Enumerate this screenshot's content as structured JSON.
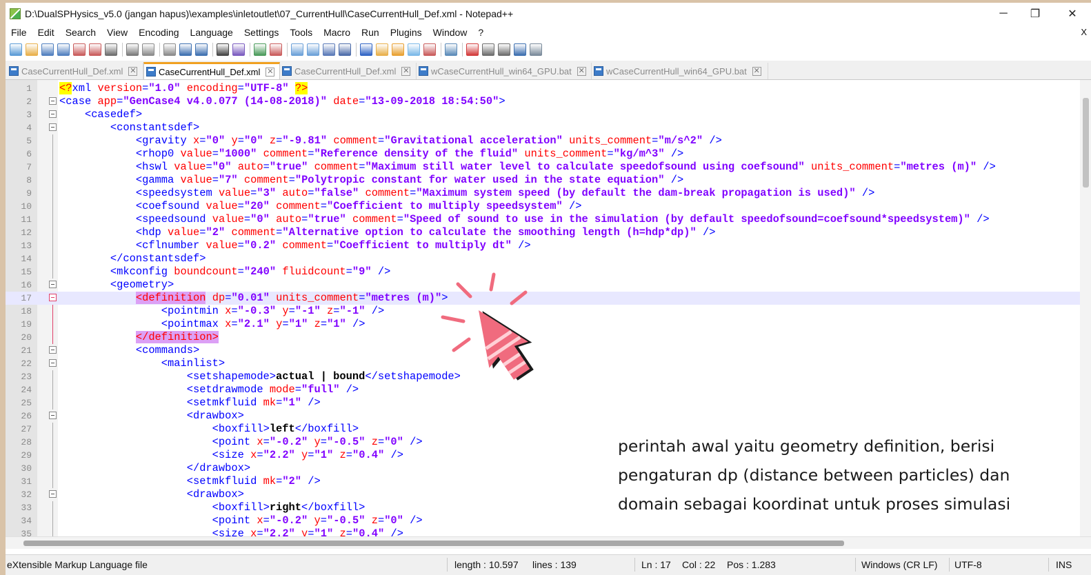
{
  "window": {
    "title": "D:\\DualSPHysics_v5.0 (jangan hapus)\\examples\\inletoutlet\\07_CurrentHull\\CaseCurrentHull_Def.xml - Notepad++",
    "minimize": "─",
    "restore": "❐",
    "close": "✕"
  },
  "menu": {
    "items": [
      "File",
      "Edit",
      "Search",
      "View",
      "Encoding",
      "Language",
      "Settings",
      "Tools",
      "Macro",
      "Run",
      "Plugins",
      "Window",
      "?"
    ],
    "close_doc": "X"
  },
  "toolbar": {
    "icons": [
      "new-file",
      "open-file",
      "save",
      "save-all",
      "close",
      "close-all",
      "print",
      "cut",
      "copy",
      "paste",
      "undo",
      "redo",
      "find",
      "replace",
      "zoom-in",
      "zoom-out",
      "sync-v",
      "sync-h",
      "word-wrap",
      "show-all-chars",
      "indent-guide",
      "udl",
      "doc-map",
      "function-list",
      "folder-workspace",
      "monitor",
      "record-macro",
      "stop-macro",
      "play-macro",
      "run-macro-multiple",
      "save-macro"
    ]
  },
  "tabs": [
    {
      "label": "CaseCurrentHull_Def.xml",
      "active": false
    },
    {
      "label": "CaseCurrentHull_Def.xml",
      "active": true
    },
    {
      "label": "CaseCurrentHull_Def.xml",
      "active": false
    },
    {
      "label": "wCaseCurrentHull_win64_GPU.bat",
      "active": false
    },
    {
      "label": "wCaseCurrentHull_win64_GPU.bat",
      "active": false
    }
  ],
  "editor": {
    "first_line": 1,
    "lines": [
      "<?xml version=\"1.0\" encoding=\"UTF-8\" ?>",
      "<case app=\"GenCase4 v4.0.077 (14-08-2018)\" date=\"13-09-2018 18:54:50\">",
      "    <casedef>",
      "        <constantsdef>",
      "            <gravity x=\"0\" y=\"0\" z=\"-9.81\" comment=\"Gravitational acceleration\" units_comment=\"m/s^2\" />",
      "            <rhop0 value=\"1000\" comment=\"Reference density of the fluid\" units_comment=\"kg/m^3\" />",
      "            <hswl value=\"0\" auto=\"true\" comment=\"Maximum still water level to calculate speedofsound using coefsound\" units_comment=\"metres (m)\" />",
      "            <gamma value=\"7\" comment=\"Polytropic constant for water used in the state equation\" />",
      "            <speedsystem value=\"3\" auto=\"false\" comment=\"Maximum system speed (by default the dam-break propagation is used)\" />",
      "            <coefsound value=\"20\" comment=\"Coefficient to multiply speedsystem\" />",
      "            <speedsound value=\"0\" auto=\"true\" comment=\"Speed of sound to use in the simulation (by default speedofsound=coefsound*speedsystem)\" />",
      "            <hdp value=\"2\" comment=\"Alternative option to calculate the smoothing length (h=hdp*dp)\" />",
      "            <cflnumber value=\"0.2\" comment=\"Coefficient to multiply dt\" />",
      "        </constantsdef>",
      "        <mkconfig boundcount=\"240\" fluidcount=\"9\" />",
      "        <geometry>",
      "            <definition dp=\"0.01\" units_comment=\"metres (m)\">",
      "                <pointmin x=\"-0.3\" y=\"-1\" z=\"-1\" />",
      "                <pointmax x=\"2.1\" y=\"1\" z=\"1\" />",
      "            </definition>",
      "            <commands>",
      "                <mainlist>",
      "                    <setshapemode>actual | bound</setshapemode>",
      "                    <setdrawmode mode=\"full\" />",
      "                    <setmkfluid mk=\"1\" />",
      "                    <drawbox>",
      "                        <boxfill>left</boxfill>",
      "                        <point x=\"-0.2\" y=\"-0.5\" z=\"0\" />",
      "                        <size x=\"2.2\" y=\"1\" z=\"0.4\" />",
      "                    </drawbox>",
      "                    <setmkfluid mk=\"2\" />",
      "                    <drawbox>",
      "                        <boxfill>right</boxfill>",
      "                        <point x=\"-0.2\" y=\"-0.5\" z=\"0\" />",
      "                        <size x=\"2.2\" y=\"1\" z=\"0.4\" />"
    ],
    "current_line": 17
  },
  "caption": "perintah awal yaitu geometry definition, berisi pengaturan dp (distance between particles) dan domain sebagai koordinat untuk proses simulasi",
  "status": {
    "file_type": "eXtensible Markup Language file",
    "length": "length : 10.597",
    "lines": "lines : 139",
    "ln": "Ln : 17",
    "col": "Col : 22",
    "pos": "Pos : 1.283",
    "eol": "Windows (CR LF)",
    "encoding": "UTF-8",
    "mode": "INS"
  },
  "colors": {
    "tag": "#0000ff",
    "attribute": "#ff0000",
    "value": "#8000ff",
    "active_tab_accent": "#f0a020",
    "current_line": "#e8e8ff",
    "cursor_pink": "#f06b7e"
  }
}
